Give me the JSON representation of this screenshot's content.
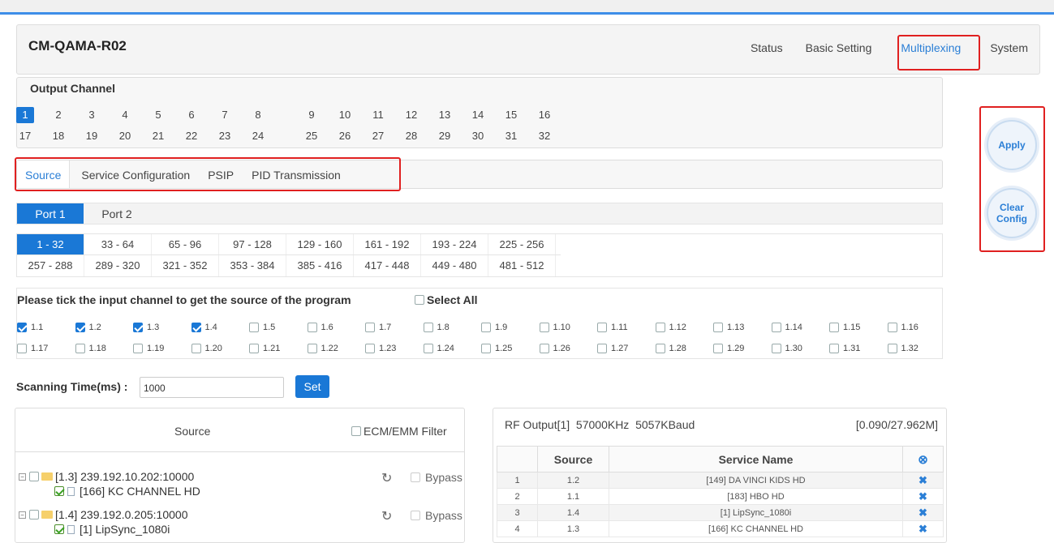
{
  "app": {
    "title": "CM-QAMA-R02"
  },
  "nav": [
    "Status",
    "Basic Setting",
    "Multiplexing",
    "System"
  ],
  "output_channel": {
    "title": "Output Channel",
    "row1": [
      "1",
      "2",
      "3",
      "4",
      "5",
      "6",
      "7",
      "8",
      "9",
      "10",
      "11",
      "12",
      "13",
      "14",
      "15",
      "16"
    ],
    "row2": [
      "17",
      "18",
      "19",
      "20",
      "21",
      "22",
      "23",
      "24",
      "25",
      "26",
      "27",
      "28",
      "29",
      "30",
      "31",
      "32"
    ],
    "selected": "1"
  },
  "tabs": [
    "Source",
    "Service Configuration",
    "PSIP",
    "PID Transmission"
  ],
  "ports": [
    "Port 1",
    "Port 2"
  ],
  "ranges": {
    "row1": [
      "1 - 32",
      "33 - 64",
      "65 - 96",
      "97 - 128",
      "129 - 160",
      "161 - 192",
      "193 - 224",
      "225 - 256"
    ],
    "row2": [
      "257 - 288",
      "289 - 320",
      "321 - 352",
      "353 - 384",
      "385 - 416",
      "417 - 448",
      "449 - 480",
      "481 - 512"
    ]
  },
  "tick": {
    "instruction": "Please tick the input channel to get the source of the program",
    "select_all": "Select All",
    "row1": [
      {
        "label": "1.1",
        "checked": true
      },
      {
        "label": "1.2",
        "checked": true
      },
      {
        "label": "1.3",
        "checked": true
      },
      {
        "label": "1.4",
        "checked": true
      },
      {
        "label": "1.5",
        "checked": false
      },
      {
        "label": "1.6",
        "checked": false
      },
      {
        "label": "1.7",
        "checked": false
      },
      {
        "label": "1.8",
        "checked": false
      },
      {
        "label": "1.9",
        "checked": false
      },
      {
        "label": "1.10",
        "checked": false
      },
      {
        "label": "1.11",
        "checked": false
      },
      {
        "label": "1.12",
        "checked": false
      },
      {
        "label": "1.13",
        "checked": false
      },
      {
        "label": "1.14",
        "checked": false
      },
      {
        "label": "1.15",
        "checked": false
      },
      {
        "label": "1.16",
        "checked": false
      }
    ],
    "row2": [
      {
        "label": "1.17",
        "checked": false
      },
      {
        "label": "1.18",
        "checked": false
      },
      {
        "label": "1.19",
        "checked": false
      },
      {
        "label": "1.20",
        "checked": false
      },
      {
        "label": "1.21",
        "checked": false
      },
      {
        "label": "1.22",
        "checked": false
      },
      {
        "label": "1.23",
        "checked": false
      },
      {
        "label": "1.24",
        "checked": false
      },
      {
        "label": "1.25",
        "checked": false
      },
      {
        "label": "1.26",
        "checked": false
      },
      {
        "label": "1.27",
        "checked": false
      },
      {
        "label": "1.28",
        "checked": false
      },
      {
        "label": "1.29",
        "checked": false
      },
      {
        "label": "1.30",
        "checked": false
      },
      {
        "label": "1.31",
        "checked": false
      },
      {
        "label": "1.32",
        "checked": false
      }
    ]
  },
  "scan": {
    "label": "Scanning Time(ms) :",
    "value": "1000",
    "set_label": "Set"
  },
  "source": {
    "title": "Source",
    "ecm_filter": "ECM/EMM Filter",
    "bypass": "Bypass",
    "items": [
      {
        "input": "[1.3] 239.192.10.202:10000",
        "service": "[166] KC CHANNEL HD"
      },
      {
        "input": "[1.4] 239.192.0.205:10000",
        "service": "[1] LipSync_1080i"
      }
    ]
  },
  "rf": {
    "header": "RF Output[1]  57000KHz  5057KBaud",
    "rate": "[0.090/27.962M]",
    "columns": [
      "Source",
      "Service Name"
    ],
    "rows": [
      {
        "idx": "1",
        "source": "1.2",
        "service": "[149] DA VINCI KIDS HD"
      },
      {
        "idx": "2",
        "source": "1.1",
        "service": "[183] HBO HD"
      },
      {
        "idx": "3",
        "source": "1.4",
        "service": "[1] LipSync_1080i"
      },
      {
        "idx": "4",
        "source": "1.3",
        "service": "[166] KC CHANNEL HD"
      }
    ]
  },
  "side": {
    "apply": "Apply",
    "clear": "Clear Config"
  },
  "icons": {
    "remove": "x-icon",
    "remove_all": "circle-x-icon",
    "refresh": "refresh-icon",
    "folder": "folder-icon",
    "file": "file-icon"
  },
  "colors": {
    "accent": "#1a78d6",
    "highlight": "#e02020"
  }
}
